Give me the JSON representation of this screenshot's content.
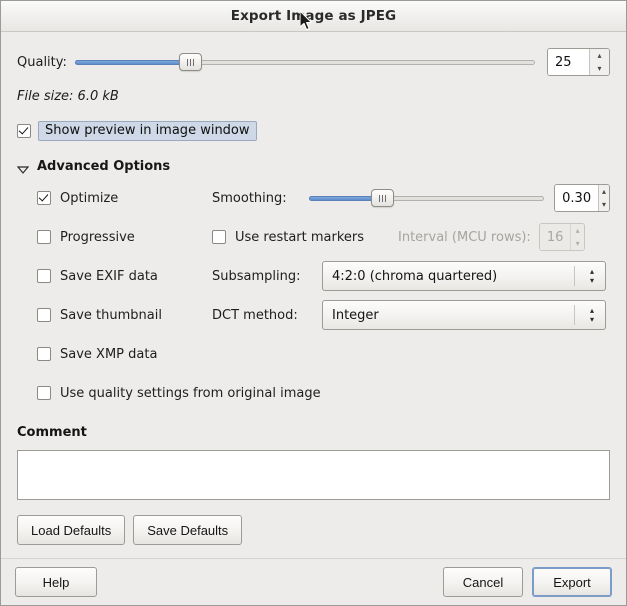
{
  "window": {
    "title": "Export Image as JPEG"
  },
  "quality": {
    "label": "Quality:",
    "value": "25",
    "slider_percent": 25,
    "min": 0,
    "max": 100
  },
  "file_size": {
    "text": "File size: 6.0 kB"
  },
  "preview": {
    "label": "Show preview in image window",
    "checked": true
  },
  "advanced": {
    "title": "Advanced Options",
    "expanded": true,
    "checkboxes": [
      {
        "name": "optimize",
        "label": "Optimize",
        "checked": true,
        "enabled": true
      },
      {
        "name": "progressive",
        "label": "Progressive",
        "checked": false,
        "enabled": true
      },
      {
        "name": "save-exif",
        "label": "Save EXIF data",
        "checked": false,
        "enabled": true
      },
      {
        "name": "save-thumbnail",
        "label": "Save thumbnail",
        "checked": false,
        "enabled": true
      },
      {
        "name": "save-xmp",
        "label": "Save XMP data",
        "checked": false,
        "enabled": true
      },
      {
        "name": "use-quality-original",
        "label": "Use quality settings from original image",
        "checked": false,
        "enabled": true
      }
    ],
    "smoothing": {
      "label": "Smoothing:",
      "value": "0.30",
      "slider_percent": 31,
      "min": 0,
      "max": 1
    },
    "restart_markers": {
      "label": "Use restart markers",
      "checked": false
    },
    "interval": {
      "label": "Interval (MCU rows):",
      "value": "16",
      "enabled": false
    },
    "subsampling": {
      "label": "Subsampling:",
      "value": "4:2:0 (chroma quartered)"
    },
    "dct_method": {
      "label": "DCT method:",
      "value": "Integer"
    }
  },
  "comment": {
    "title": "Comment",
    "value": "",
    "placeholder": ""
  },
  "defaults": {
    "load_label": "Load Defaults",
    "save_label": "Save Defaults"
  },
  "actions": {
    "help_label": "Help",
    "cancel_label": "Cancel",
    "export_label": "Export"
  },
  "colors": {
    "window_bg": "#edecea",
    "slider_fill": "#6d9bd6",
    "focus_ring": "#7a9cc6",
    "focus_label_bg": "#ced8e6",
    "disabled_text": "#a6a4a0"
  },
  "icons": {
    "spin_up": "▴",
    "spin_down": "▾",
    "combo_up": "▴",
    "combo_down": "▾"
  }
}
